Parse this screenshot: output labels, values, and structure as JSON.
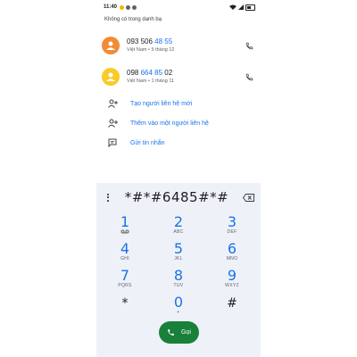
{
  "status_bar": {
    "time": "11:40",
    "battery": "47"
  },
  "recents": {
    "section_label": "Không có trong danh bạ",
    "contacts": [
      {
        "number_prefix": "093 506 ",
        "number_match": "48 55",
        "number_suffix": "",
        "subtitle": "Việt Nam • 5 tháng 12",
        "avatar_color": "#f28b36",
        "avatar_icon": "person-icon"
      },
      {
        "number_prefix": "098 ",
        "number_match": "664 85",
        "number_suffix": " 02",
        "subtitle": "Việt Nam • 1 tháng 11",
        "avatar_color": "#f9cb28",
        "avatar_icon": "person-icon"
      }
    ]
  },
  "actions": [
    {
      "label": "Tạo người liên hệ mới",
      "icon": "person-add-icon"
    },
    {
      "label": "Thêm vào một người liên hệ",
      "icon": "person-add-icon"
    },
    {
      "label": "Gửi tin nhắn",
      "icon": "message-icon"
    }
  ],
  "dialpad": {
    "entered": "*#*#6485#*#",
    "keys": [
      {
        "digit": "1",
        "letters": ""
      },
      {
        "digit": "2",
        "letters": "ABC"
      },
      {
        "digit": "3",
        "letters": "DEF"
      },
      {
        "digit": "4",
        "letters": "GHI"
      },
      {
        "digit": "5",
        "letters": "JKL"
      },
      {
        "digit": "6",
        "letters": "MNO"
      },
      {
        "digit": "7",
        "letters": "PQRS"
      },
      {
        "digit": "8",
        "letters": "TUV"
      },
      {
        "digit": "9",
        "letters": "WXYZ"
      },
      {
        "digit": "*",
        "letters": ""
      },
      {
        "digit": "0",
        "letters": "+"
      },
      {
        "digit": "#",
        "letters": ""
      }
    ],
    "call_label": "Gọi"
  },
  "colors": {
    "accent": "#1a73e8",
    "call_green": "#188038",
    "dialpad_bg": "#eef2f8"
  }
}
